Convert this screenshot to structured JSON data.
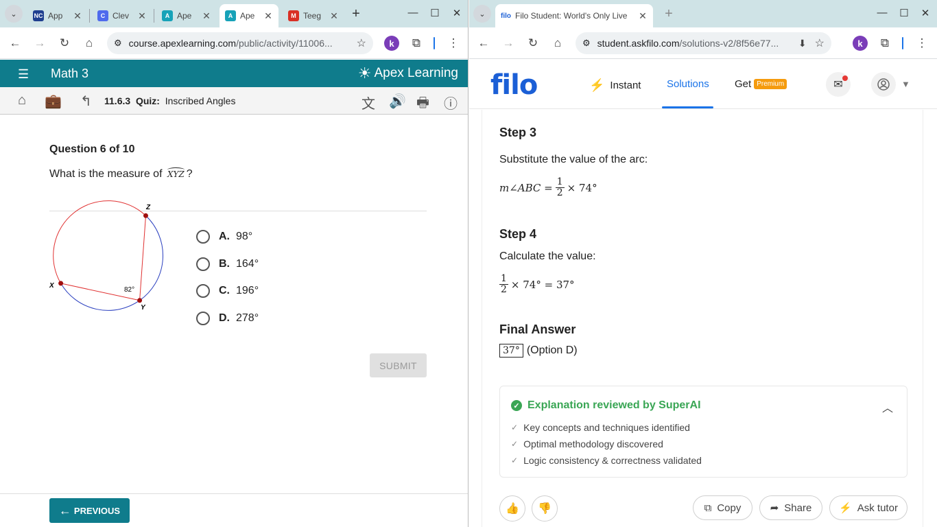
{
  "left_browser": {
    "tabs": [
      {
        "label": "App",
        "favicon": "NC",
        "favicon_color": "#1f3f8f"
      },
      {
        "label": "Clev",
        "favicon": "C",
        "favicon_color": "#4f6bed"
      },
      {
        "label": "Ape",
        "favicon": "A",
        "favicon_color": "#17a2b8"
      },
      {
        "label": "Ape",
        "favicon": "A",
        "favicon_color": "#17a2b8",
        "active": true
      },
      {
        "label": "Teeg",
        "favicon": "M",
        "favicon_color": "#d93025"
      }
    ],
    "url_host": "course.apexlearning.com",
    "url_path": "/public/activity/11006...",
    "profile_letter": "k"
  },
  "apex": {
    "course_title": "Math 3",
    "brand": "Apex Learning",
    "breadcrumb_number": "11.6.3",
    "breadcrumb_type": "Quiz:",
    "breadcrumb_title": "Inscribed Angles",
    "question_header": "Question 6 of 10",
    "question_prefix": "What is the measure of",
    "question_arc": "XYZ",
    "question_suffix": "?",
    "diagram": {
      "label_z": "Z",
      "label_x": "X",
      "label_y": "Y",
      "angle_label": "82°"
    },
    "options": [
      {
        "letter": "A.",
        "value": "98°"
      },
      {
        "letter": "B.",
        "value": "164°"
      },
      {
        "letter": "C.",
        "value": "196°"
      },
      {
        "letter": "D.",
        "value": "278°"
      }
    ],
    "submit_label": "SUBMIT",
    "previous_label": "PREVIOUS",
    "accent_color": "#0f7c8c"
  },
  "right_browser": {
    "tab_title": "Filo Student: World's Only Live",
    "tab_favicon": "filo",
    "url_host": "student.askfilo.com",
    "url_path": "/solutions-v2/8f56e77...",
    "profile_letter": "k"
  },
  "filo": {
    "logo": "filo",
    "nav_instant": "Instant",
    "nav_solutions": "Solutions",
    "nav_get": "Get",
    "premium_badge": "Premium",
    "step3_title": "Step 3",
    "step3_text": "Substitute the value of the arc:",
    "step3_math_left": "m∠ABC =",
    "step3_math_right": "× 74°",
    "frac_num": "1",
    "frac_den": "2",
    "step4_title": "Step 4",
    "step4_text": "Calculate the value:",
    "step4_math_right": "× 74° = 37°",
    "final_title": "Final Answer",
    "final_value": "37°",
    "final_option": "(Option D)",
    "review_title": "Explanation reviewed by SuperAI",
    "review_items": [
      "Key concepts and techniques identified",
      "Optimal methodology discovered",
      "Logic consistency & correctness validated"
    ],
    "copy_label": "Copy",
    "share_label": "Share",
    "ask_tutor_label": "Ask tutor",
    "brand_color": "#1b5fd6",
    "verified_color": "#3aa655"
  }
}
